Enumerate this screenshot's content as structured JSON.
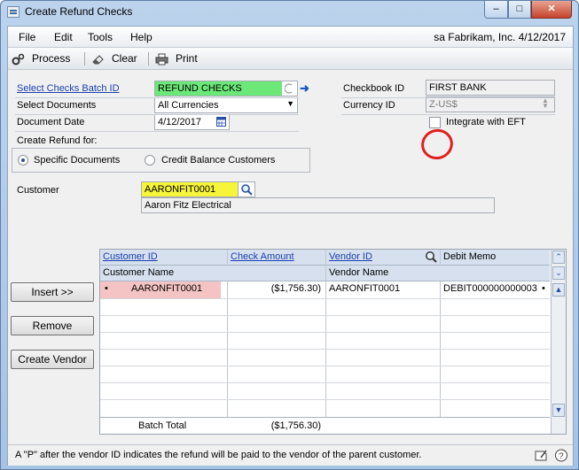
{
  "window": {
    "title": "Create Refund Checks"
  },
  "menu": {
    "items": [
      "File",
      "Edit",
      "Tools",
      "Help"
    ],
    "user_info": "sa  Fabrikam, Inc. 4/12/2017"
  },
  "toolbar": {
    "process": "Process",
    "clear": "Clear",
    "print": "Print"
  },
  "form": {
    "batch_id_label": "Select Checks Batch ID",
    "batch_id_value": "REFUND CHECKS",
    "select_documents_label": "Select Documents",
    "select_documents_value": "All Currencies",
    "document_date_label": "Document Date",
    "document_date_value": "4/12/2017",
    "checkbook_id_label": "Checkbook ID",
    "checkbook_id_value": "FIRST BANK",
    "currency_id_label": "Currency ID",
    "currency_id_value": "Z-US$",
    "integrate_eft_label": "Integrate with EFT",
    "create_refund_for_label": "Create Refund for:",
    "specific_documents_label": "Specific Documents",
    "credit_balance_label": "Credit Balance Customers",
    "customer_label": "Customer",
    "customer_value": "AARONFIT0001",
    "customer_name_value": "Aaron Fitz Electrical"
  },
  "grid": {
    "headers_row1": {
      "customer_id": "Customer ID",
      "check_amount": "Check Amount",
      "vendor_id": "Vendor ID",
      "debit_memo": "Debit Memo"
    },
    "headers_row2": {
      "customer_name": "Customer Name",
      "vendor_name": "Vendor Name"
    },
    "rows": [
      {
        "marker": "•",
        "customer_id": "AARONFIT0001",
        "check_amount": "($1,756.30)",
        "vendor_id": "AARONFIT0001",
        "debit_memo": "DEBIT000000000003",
        "memo_marker": "•"
      }
    ],
    "batch_total_label": "Batch Total",
    "batch_total_value": "($1,756.30)"
  },
  "buttons": {
    "insert": "Insert >>",
    "remove": "Remove",
    "create_vendor": "Create Vendor"
  },
  "status_text": "A \"P\" after the vendor ID indicates the refund will be paid to the vendor of the parent customer.",
  "colors": {
    "highlight_yellow": "#f6f53a",
    "highlight_green": "#6ce879",
    "row_highlight": "#f4c3c3",
    "annotation_red": "#e0201c"
  }
}
